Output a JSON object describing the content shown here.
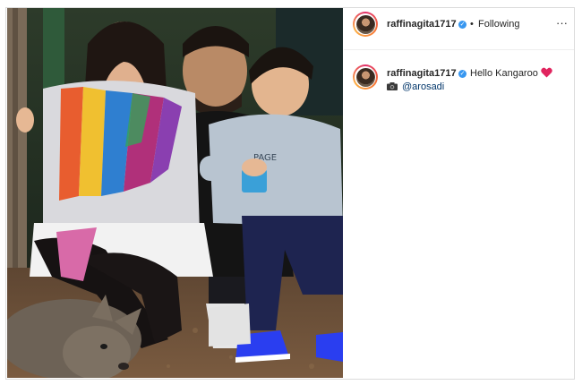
{
  "post": {
    "author": {
      "username": "raffinagita1717",
      "verified_icon": "verified-badge-icon",
      "follow_status": "Following",
      "separator": "•"
    },
    "more_icon": "more-options-icon",
    "more_glyph": "···",
    "caption": {
      "username": "raffinagita1717",
      "text": "Hello Kangaroo",
      "emoji_icon": "red-heart-icon",
      "credit_icon": "camera-icon",
      "credit_mention": "@arosadi"
    },
    "photo": {
      "subject": "family-photo",
      "colors": {
        "background": "#1e2a20",
        "ground": "#6b5038"
      }
    }
  },
  "colors": {
    "verified": "#3897f0",
    "heart": "#e0245e",
    "mention": "#003569",
    "text": "#262626",
    "border": "#dbdbdb"
  }
}
